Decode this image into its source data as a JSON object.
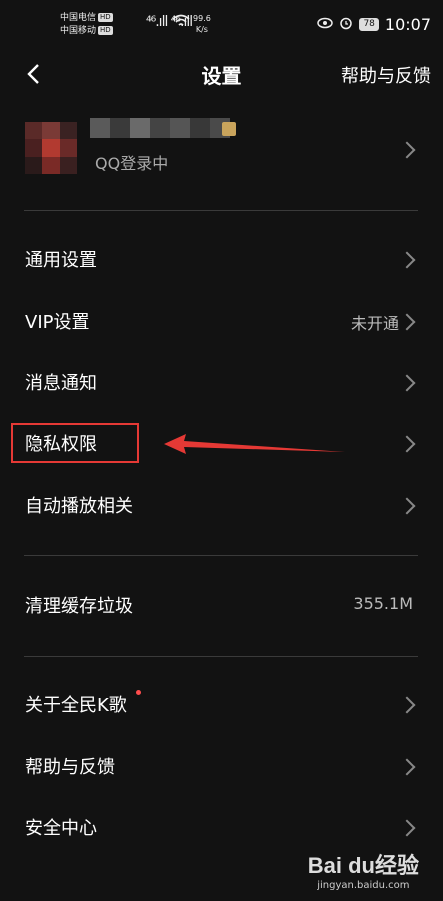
{
  "status_bar": {
    "carrier1": "中国电信",
    "carrier2": "中国移动",
    "hd": "HD",
    "signal": "⁴⁶.ıll ⁴⁶.ıll",
    "speed_value": "99.6",
    "speed_unit": "K/s",
    "battery": "78",
    "time": "10:07"
  },
  "header": {
    "title": "设置",
    "help_label": "帮助与反馈"
  },
  "profile": {
    "login_status": "QQ登录中"
  },
  "menu": {
    "general": "通用设置",
    "vip": "VIP设置",
    "vip_value": "未开通",
    "notifications": "消息通知",
    "privacy": "隐私权限",
    "autoplay": "自动播放相关",
    "cache": "清理缓存垃圾",
    "cache_value": "355.1M",
    "about": "关于全民K歌",
    "help": "帮助与反馈",
    "security": "安全中心"
  },
  "watermark": {
    "logo": "Bai du经验",
    "url": "jingyan.baidu.com"
  },
  "colors": {
    "background": "#121212",
    "highlight": "#e53935",
    "accent_dot": "#ff4d4d"
  }
}
